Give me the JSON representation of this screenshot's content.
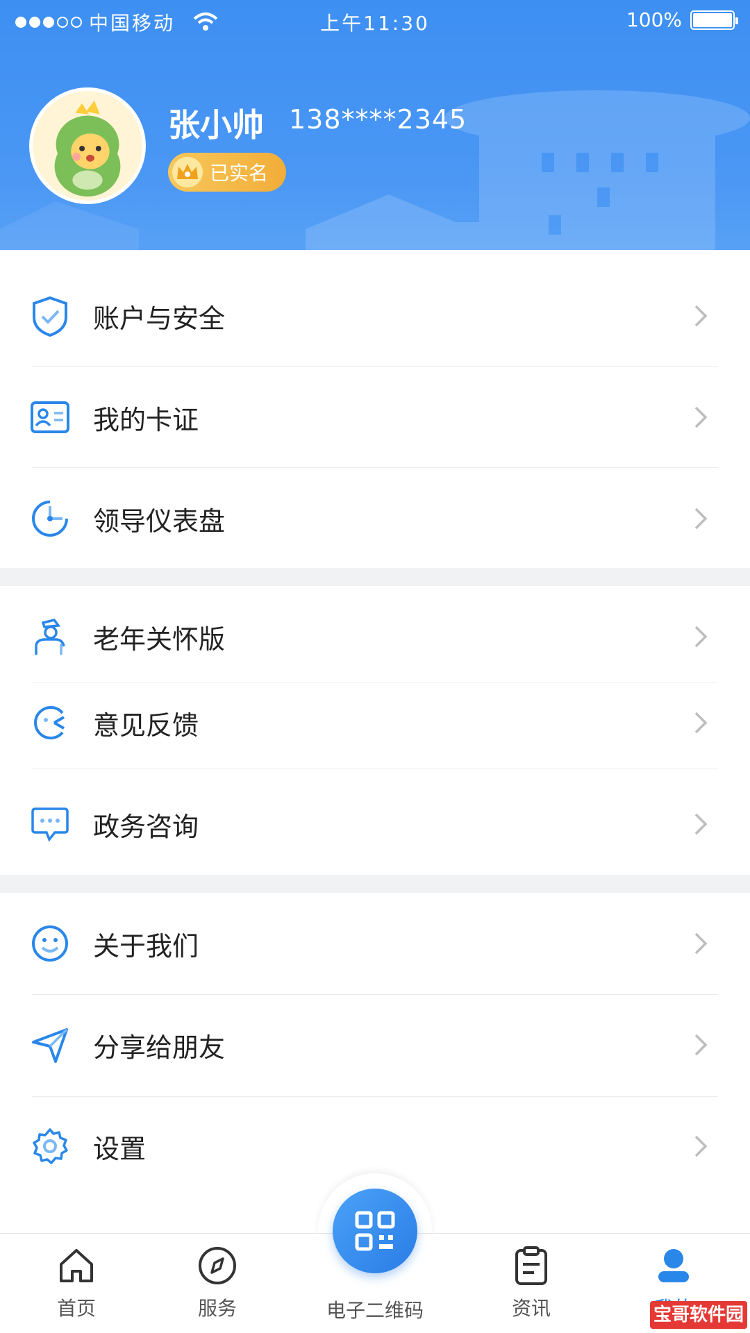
{
  "status_bar": {
    "carrier": "中国移动",
    "time": "上午11:30",
    "battery": "100%"
  },
  "profile": {
    "name": "张小帅",
    "phone": "138****2345",
    "verified_label": "已实名"
  },
  "menu_groups": [
    {
      "items": [
        {
          "label": "账户与安全",
          "icon": "shield-check-icon"
        },
        {
          "label": "我的卡证",
          "icon": "id-card-icon"
        },
        {
          "label": "领导仪表盘",
          "icon": "dashboard-pie-icon"
        }
      ]
    },
    {
      "items": [
        {
          "label": "老年关怀版",
          "icon": "elderly-person-icon"
        },
        {
          "label": "意见反馈",
          "icon": "feedback-icon"
        },
        {
          "label": "政务咨询",
          "icon": "chat-bubble-icon"
        }
      ]
    },
    {
      "items": [
        {
          "label": "关于我们",
          "icon": "smiley-icon"
        },
        {
          "label": "分享给朋友",
          "icon": "send-arrow-icon"
        },
        {
          "label": "设置",
          "icon": "gear-icon"
        }
      ]
    }
  ],
  "tabbar": {
    "home": "首页",
    "services": "服务",
    "qrcode": "电子二维码",
    "news": "资讯",
    "mine": "我的"
  },
  "watermark": "宝哥软件园",
  "colors": {
    "primary": "#2a87ea",
    "header_bg": "#3d8ff2",
    "badge": "#f2ad38"
  }
}
